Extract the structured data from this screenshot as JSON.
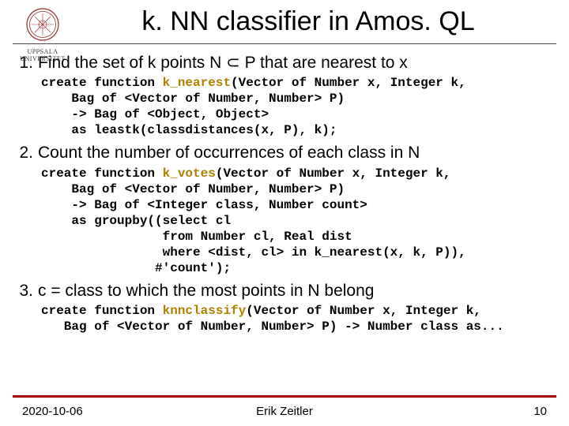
{
  "logo": {
    "caption": "UPPSALA",
    "caption2": "UNIVERSITET"
  },
  "title": "k. NN classifier in Amos. QL",
  "steps": [
    {
      "num": "1.",
      "text_before": "Find the set of k points N ",
      "subset": "⊂",
      "text_after": " P that are nearest to x",
      "code_prefix": "create function ",
      "fn": "k_nearest",
      "code_after": "(Vector of Number x, Integer k,\n    Bag of <Vector of Number, Number> P)\n    -> Bag of <Object, Object>\n    as leastk(classdistances(x, P), k);"
    },
    {
      "num": "2.",
      "text_before": "Count the number of occurrences of each class in N",
      "subset": "",
      "text_after": "",
      "code_prefix": "create function ",
      "fn": "k_votes",
      "code_after": "(Vector of Number x, Integer k,\n    Bag of <Vector of Number, Number> P)\n    -> Bag of <Integer class, Number count>\n    as groupby((select cl\n                from Number cl, Real dist\n                where <dist, cl> in k_nearest(x, k, P)),\n               #'count');"
    },
    {
      "num": "3.",
      "text_before": "c = class to which the most points in N belong",
      "subset": "",
      "text_after": "",
      "code_prefix": "create function ",
      "fn": "knnclassify",
      "code_after": "(Vector of Number x, Integer k,\n   Bag of <Vector of Number, Number> P) -> Number class as..."
    }
  ],
  "footer": {
    "date": "2020-10-06",
    "author": "Erik Zeitler",
    "page": "10"
  }
}
